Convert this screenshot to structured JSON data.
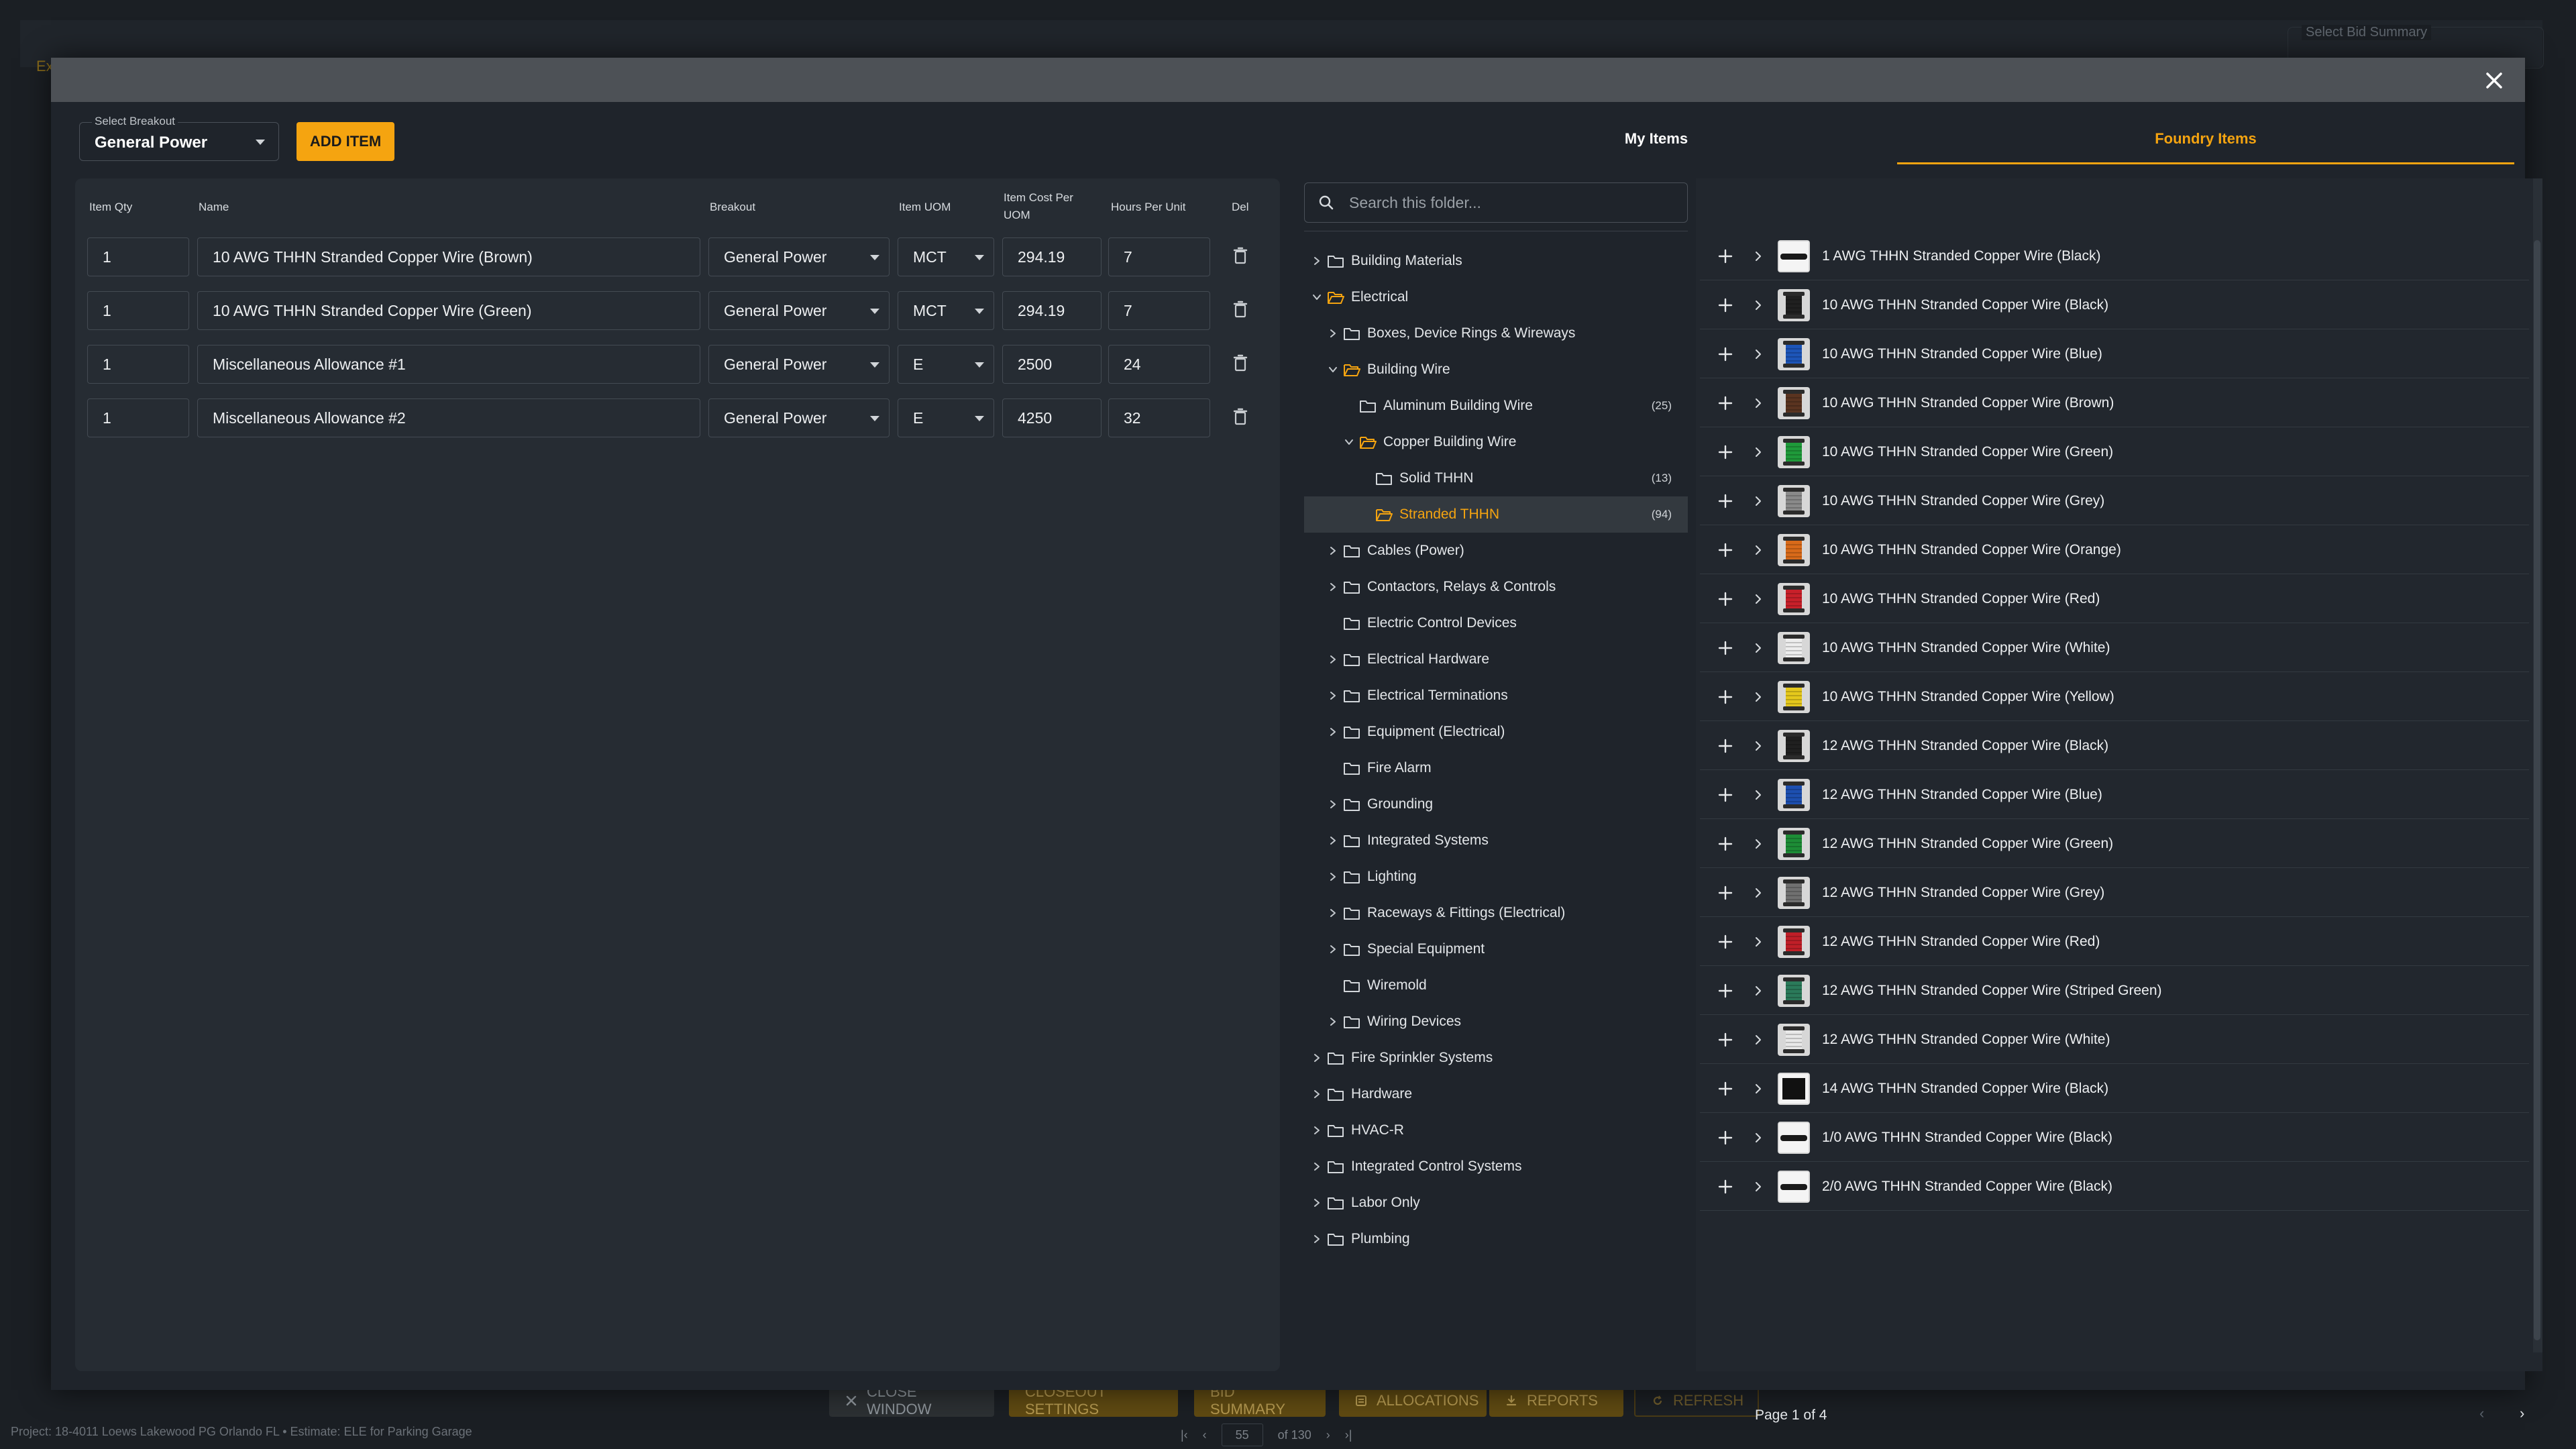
{
  "background": {
    "bid_summary_label": "Select Bid Summary",
    "tab_fragment": "Ex",
    "buttons": [
      {
        "label": "CLOSE WINDOW",
        "icon": "close-icon",
        "style": "dark"
      },
      {
        "label": "CLOSEOUT SETTINGS",
        "icon": "",
        "style": "gold"
      },
      {
        "label": "BID SUMMARY",
        "icon": "",
        "style": "gold"
      },
      {
        "label": "ALLOCATIONS",
        "icon": "list-icon",
        "style": "gold"
      },
      {
        "label": "REPORTS",
        "icon": "download-icon",
        "style": "gold"
      },
      {
        "label": "REFRESH",
        "icon": "refresh-icon",
        "style": "outline"
      }
    ],
    "footer_text": "Project: 18-4011 Loews Lakewood PG Orlando FL • Estimate: ELE for Parking Garage",
    "pager": {
      "page": "55",
      "of": "of 130"
    }
  },
  "modal": {
    "close_icon": "close-icon",
    "breakout": {
      "label": "Select Breakout",
      "value": "General Power"
    },
    "add_item_label": "ADD ITEM",
    "columns": {
      "qty": "Item Qty",
      "name": "Name",
      "breakout": "Breakout",
      "uom": "Item UOM",
      "cost": "Item Cost Per UOM",
      "hours": "Hours Per Unit",
      "del": "Del"
    },
    "rows": [
      {
        "qty": "1",
        "name": "10 AWG THHN Stranded Copper Wire (Brown)",
        "breakout": "General Power",
        "uom": "MCT",
        "cost": "294.19",
        "hours": "7"
      },
      {
        "qty": "1",
        "name": "10 AWG THHN Stranded Copper Wire (Green)",
        "breakout": "General Power",
        "uom": "MCT",
        "cost": "294.19",
        "hours": "7"
      },
      {
        "qty": "1",
        "name": "Miscellaneous Allowance #1",
        "breakout": "General Power",
        "uom": "E",
        "cost": "2500",
        "hours": "24"
      },
      {
        "qty": "1",
        "name": "Miscellaneous Allowance #2",
        "breakout": "General Power",
        "uom": "E",
        "cost": "4250",
        "hours": "32"
      }
    ],
    "tabs": {
      "my_items": "My Items",
      "foundry_items": "Foundry Items",
      "active": "foundry_items"
    },
    "search_placeholder": "Search this folder...",
    "tree": [
      {
        "label": "Building Materials",
        "level": 0,
        "expand": "collapsed",
        "open": false
      },
      {
        "label": "Electrical",
        "level": 0,
        "expand": "expanded",
        "open": true
      },
      {
        "label": "Boxes, Device Rings & Wireways",
        "level": 1,
        "expand": "collapsed",
        "open": false
      },
      {
        "label": "Building Wire",
        "level": 1,
        "expand": "expanded",
        "open": true
      },
      {
        "label": "Aluminum Building Wire",
        "level": 2,
        "expand": "none",
        "open": false,
        "count": "(25)"
      },
      {
        "label": "Copper Building Wire",
        "level": 2,
        "expand": "expanded",
        "open": true
      },
      {
        "label": "Solid THHN",
        "level": 3,
        "expand": "none",
        "open": false,
        "count": "(13)"
      },
      {
        "label": "Stranded THHN",
        "level": 3,
        "expand": "none",
        "open": true,
        "count": "(94)",
        "active": true
      },
      {
        "label": "Cables (Power)",
        "level": 1,
        "expand": "collapsed",
        "open": false
      },
      {
        "label": "Contactors, Relays & Controls",
        "level": 1,
        "expand": "collapsed",
        "open": false
      },
      {
        "label": "Electric Control Devices",
        "level": 1,
        "expand": "none",
        "open": false
      },
      {
        "label": "Electrical Hardware",
        "level": 1,
        "expand": "collapsed",
        "open": false
      },
      {
        "label": "Electrical Terminations",
        "level": 1,
        "expand": "collapsed",
        "open": false
      },
      {
        "label": "Equipment (Electrical)",
        "level": 1,
        "expand": "collapsed",
        "open": false
      },
      {
        "label": "Fire Alarm",
        "level": 1,
        "expand": "none",
        "open": false
      },
      {
        "label": "Grounding",
        "level": 1,
        "expand": "collapsed",
        "open": false
      },
      {
        "label": "Integrated Systems",
        "level": 1,
        "expand": "collapsed",
        "open": false
      },
      {
        "label": "Lighting",
        "level": 1,
        "expand": "collapsed",
        "open": false
      },
      {
        "label": "Raceways & Fittings (Electrical)",
        "level": 1,
        "expand": "collapsed",
        "open": false
      },
      {
        "label": "Special Equipment",
        "level": 1,
        "expand": "collapsed",
        "open": false
      },
      {
        "label": "Wiremold",
        "level": 1,
        "expand": "none",
        "open": false
      },
      {
        "label": "Wiring Devices",
        "level": 1,
        "expand": "collapsed",
        "open": false
      },
      {
        "label": "Fire Sprinkler Systems",
        "level": 0,
        "expand": "collapsed",
        "open": false
      },
      {
        "label": "Hardware",
        "level": 0,
        "expand": "collapsed",
        "open": false
      },
      {
        "label": "HVAC-R",
        "level": 0,
        "expand": "collapsed",
        "open": false
      },
      {
        "label": "Integrated Control Systems",
        "level": 0,
        "expand": "collapsed",
        "open": false
      },
      {
        "label": "Labor Only",
        "level": 0,
        "expand": "collapsed",
        "open": false
      },
      {
        "label": "Plumbing",
        "level": 0,
        "expand": "collapsed",
        "open": false
      }
    ],
    "results": [
      {
        "name": "1 AWG THHN Stranded Copper Wire (Black)",
        "color": "#1a1a1a",
        "style": "cable"
      },
      {
        "name": "10 AWG THHN Stranded Copper Wire (Black)",
        "color": "#202020",
        "style": "spool"
      },
      {
        "name": "10 AWG THHN Stranded Copper Wire (Blue)",
        "color": "#1d55b8",
        "style": "spool"
      },
      {
        "name": "10 AWG THHN Stranded Copper Wire (Brown)",
        "color": "#5a3420",
        "style": "spool"
      },
      {
        "name": "10 AWG THHN Stranded Copper Wire (Green)",
        "color": "#1f9a3a",
        "style": "spool"
      },
      {
        "name": "10 AWG THHN Stranded Copper Wire (Grey)",
        "color": "#8a8a8a",
        "style": "spool"
      },
      {
        "name": "10 AWG THHN Stranded Copper Wire (Orange)",
        "color": "#d86a1a",
        "style": "spool"
      },
      {
        "name": "10 AWG THHN Stranded Copper Wire (Red)",
        "color": "#c8202a",
        "style": "spool"
      },
      {
        "name": "10 AWG THHN Stranded Copper Wire (White)",
        "color": "#ededed",
        "style": "spool"
      },
      {
        "name": "10 AWG THHN Stranded Copper Wire (Yellow)",
        "color": "#e5c81c",
        "style": "spool"
      },
      {
        "name": "12 AWG THHN Stranded Copper Wire (Black)",
        "color": "#202020",
        "style": "spool"
      },
      {
        "name": "12 AWG THHN Stranded Copper Wire (Blue)",
        "color": "#1d4fb0",
        "style": "spool"
      },
      {
        "name": "12 AWG THHN Stranded Copper Wire (Green)",
        "color": "#1d8d36",
        "style": "spool"
      },
      {
        "name": "12 AWG THHN Stranded Copper Wire (Grey)",
        "color": "#707070",
        "style": "spool"
      },
      {
        "name": "12 AWG THHN Stranded Copper Wire (Red)",
        "color": "#c01f28",
        "style": "spool"
      },
      {
        "name": "12 AWG THHN Stranded Copper Wire (Striped Green)",
        "color": "#2b7a5a",
        "style": "spool"
      },
      {
        "name": "12 AWG THHN Stranded Copper Wire (White)",
        "color": "#e8e8e8",
        "style": "spool"
      },
      {
        "name": "14 AWG THHN Stranded Copper Wire (Black)",
        "color": "#111111",
        "style": "box"
      },
      {
        "name": "1/0 AWG THHN Stranded Copper Wire (Black)",
        "color": "#1a1a1a",
        "style": "cable"
      },
      {
        "name": "2/0 AWG THHN Stranded Copper Wire (Black)",
        "color": "#1a1a1a",
        "style": "cable"
      }
    ],
    "pagination": {
      "label": "Page 1 of 4"
    }
  },
  "colors": {
    "accent": "#f5a410",
    "panel": "#262c33",
    "modal": "#1f242b"
  }
}
